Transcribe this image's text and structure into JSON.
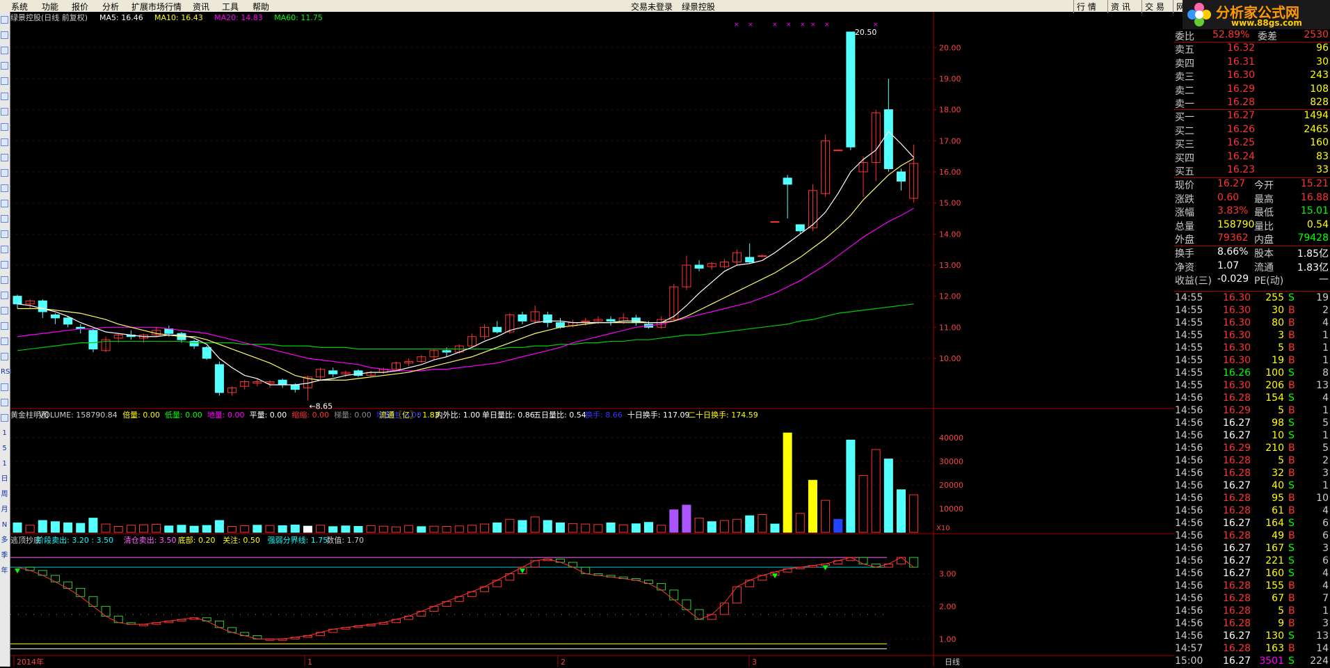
{
  "menu": [
    "系统",
    "功能",
    "报价",
    "分析",
    "扩展市场行情",
    "资讯",
    "工具",
    "帮助"
  ],
  "menu_center": [
    "交易未登录",
    "绿景控股"
  ],
  "right_tabs": [
    "行 情",
    "资 讯",
    "交 易",
    "网 上"
  ],
  "logo": {
    "text": "分析家公式网",
    "url": "www.88gs.com"
  },
  "left_tools": [
    "",
    "",
    "",
    "",
    "",
    "",
    "",
    "",
    "",
    "",
    "",
    "",
    "",
    "",
    "",
    "",
    "",
    "",
    "",
    "",
    "",
    "",
    "",
    "RSI",
    "",
    "",
    "",
    "1",
    "5",
    "1",
    "日",
    "周",
    "月",
    "N",
    "多",
    "季",
    "年"
  ],
  "price_header": {
    "name": "绿景控股(日线 前复权)",
    "ma5": "MA5: 16.46",
    "ma10": "MA10: 16.43",
    "ma20": "MA20: 14.83",
    "ma60": "MA60: 11.75"
  },
  "price_axis": [
    "20.00",
    "19.00",
    "18.00",
    "17.00",
    "16.00",
    "15.00",
    "14.00",
    "13.00",
    "12.00",
    "11.00",
    "10.00"
  ],
  "price_annotations": {
    "high": "20.50",
    "low": "8.65"
  },
  "vol_header": [
    {
      "t": "黄金柱明图",
      "c": "#cccccc"
    },
    {
      "t": "VOLUME: 158790.84",
      "c": "#cccccc"
    },
    {
      "t": "倍量: 0.00",
      "c": "#ffff00"
    },
    {
      "t": "低量: 0.00",
      "c": "#00ff00"
    },
    {
      "t": "地量: 0.00",
      "c": "#ff00ff"
    },
    {
      "t": "平量: 0.00",
      "c": "#ffffff"
    },
    {
      "t": "缩缩: 0.00",
      "c": "#ff3333"
    },
    {
      "t": "梯量: 0.00",
      "c": "#888888"
    },
    {
      "t": "增量柱: 0.00",
      "c": "#3333ff"
    },
    {
      "t": "流通〖亿〗: 1.83",
      "c": "#ffff00"
    },
    {
      "t": "内外比: 1.00",
      "c": "#ffffff"
    },
    {
      "t": "单日量比: 0.86",
      "c": "#ffffff"
    },
    {
      "t": "五日量比: 0.54",
      "c": "#ffffff"
    },
    {
      "t": "换手: 8.66",
      "c": "#3333ff"
    },
    {
      "t": "十日换手: 117.09",
      "c": "#ffffff"
    },
    {
      "t": "二十日换手: 174.59",
      "c": "#ffff00"
    }
  ],
  "vol_axis": [
    "40000",
    "30000",
    "20000",
    "10000"
  ],
  "vol_unit": "X10",
  "ind_header": [
    {
      "t": "逃顶抄底",
      "c": "#cccccc"
    },
    {
      "t": "阶段卖出: 3.20 : 3.50",
      "c": "#00ffff"
    },
    {
      "t": "清仓卖出: 3.50",
      "c": "#ff66ff"
    },
    {
      "t": "底部: 0.20",
      "c": "#ffff00"
    },
    {
      "t": "关注: 0.50",
      "c": "#ffff00"
    },
    {
      "t": "强弱分界线: 1.75",
      "c": "#00ffff"
    },
    {
      "t": "数值: 1.70",
      "c": "#cccccc"
    }
  ],
  "ind_axis": [
    "3.00",
    "2.00",
    "1.00"
  ],
  "time_axis": [
    {
      "t": "2014年",
      "x": 5
    },
    {
      "t": "1",
      "x": 423
    },
    {
      "t": "2",
      "x": 787
    },
    {
      "t": "3",
      "x": 1062
    }
  ],
  "period_label": "日线",
  "quote": {
    "weibi": {
      "label": "委比",
      "value": "52.89%",
      "label2": "委差",
      "value2": "2530"
    },
    "asks": [
      {
        "label": "卖五",
        "price": "16.32",
        "vol": "96"
      },
      {
        "label": "卖四",
        "price": "16.31",
        "vol": "30"
      },
      {
        "label": "卖三",
        "price": "16.30",
        "vol": "243"
      },
      {
        "label": "卖二",
        "price": "16.29",
        "vol": "108"
      },
      {
        "label": "卖一",
        "price": "16.28",
        "vol": "828"
      }
    ],
    "bids": [
      {
        "label": "买一",
        "price": "16.27",
        "vol": "1494"
      },
      {
        "label": "买二",
        "price": "16.26",
        "vol": "2465"
      },
      {
        "label": "买三",
        "price": "16.25",
        "vol": "160"
      },
      {
        "label": "买四",
        "price": "16.24",
        "vol": "83"
      },
      {
        "label": "买五",
        "price": "16.23",
        "vol": "33"
      }
    ],
    "stats": [
      {
        "l1": "现价",
        "v1": "16.27",
        "l2": "今开",
        "v2": "15.21"
      },
      {
        "l1": "涨跌",
        "v1": "0.60",
        "l2": "最高",
        "v2": "16.88"
      },
      {
        "l1": "涨幅",
        "v1": "3.83%",
        "l2": "最低",
        "v2": "15.01"
      },
      {
        "l1": "总量",
        "v1": "158790",
        "l2": "量比",
        "v2": "0.54"
      },
      {
        "l1": "外盘",
        "v1": "79362",
        "l2": "内盘",
        "v2": "79428"
      }
    ],
    "stats2": [
      {
        "l1": "换手",
        "v1": "8.66%",
        "l2": "股本",
        "v2": "1.85亿"
      },
      {
        "l1": "净资",
        "v1": "1.07",
        "l2": "流通",
        "v2": "1.83亿"
      },
      {
        "l1": "收益(三)",
        "v1": "-0.029",
        "l2": "PE(动)",
        "v2": "—"
      }
    ]
  },
  "ticks": [
    {
      "t": "14:55",
      "p": "16.30",
      "v": "255",
      "s": "S",
      "n": "19"
    },
    {
      "t": "14:55",
      "p": "16.30",
      "v": "30",
      "s": "B",
      "n": "2"
    },
    {
      "t": "14:55",
      "p": "16.30",
      "v": "80",
      "s": "B",
      "n": "4"
    },
    {
      "t": "14:55",
      "p": "16.30",
      "v": "3",
      "s": "B",
      "n": "1"
    },
    {
      "t": "14:55",
      "p": "16.30",
      "v": "5",
      "s": "B",
      "n": "1"
    },
    {
      "t": "14:55",
      "p": "16.30",
      "v": "19",
      "s": "B",
      "n": "1"
    },
    {
      "t": "14:55",
      "p": "16.26",
      "v": "100",
      "s": "S",
      "n": "8"
    },
    {
      "t": "14:55",
      "p": "16.30",
      "v": "206",
      "s": "B",
      "n": "13"
    },
    {
      "t": "14:56",
      "p": "16.28",
      "v": "154",
      "s": "S",
      "n": "4"
    },
    {
      "t": "14:56",
      "p": "16.29",
      "v": "5",
      "s": "B",
      "n": "1"
    },
    {
      "t": "14:56",
      "p": "16.27",
      "v": "98",
      "s": "S",
      "n": "5"
    },
    {
      "t": "14:56",
      "p": "16.27",
      "v": "10",
      "s": "S",
      "n": "1"
    },
    {
      "t": "14:56",
      "p": "16.29",
      "v": "210",
      "s": "B",
      "n": "5"
    },
    {
      "t": "14:56",
      "p": "16.28",
      "v": "5",
      "s": "B",
      "n": "2"
    },
    {
      "t": "14:56",
      "p": "16.28",
      "v": "32",
      "s": "B",
      "n": "3"
    },
    {
      "t": "14:56",
      "p": "16.27",
      "v": "40",
      "s": "S",
      "n": "1"
    },
    {
      "t": "14:56",
      "p": "16.28",
      "v": "95",
      "s": "B",
      "n": "10"
    },
    {
      "t": "14:56",
      "p": "16.28",
      "v": "61",
      "s": "B",
      "n": "4"
    },
    {
      "t": "14:56",
      "p": "16.27",
      "v": "164",
      "s": "S",
      "n": "6"
    },
    {
      "t": "14:56",
      "p": "16.28",
      "v": "49",
      "s": "B",
      "n": "6"
    },
    {
      "t": "14:56",
      "p": "16.27",
      "v": "167",
      "s": "S",
      "n": "3"
    },
    {
      "t": "14:56",
      "p": "16.27",
      "v": "221",
      "s": "S",
      "n": "6"
    },
    {
      "t": "14:56",
      "p": "16.27",
      "v": "160",
      "s": "S",
      "n": "4"
    },
    {
      "t": "14:56",
      "p": "16.28",
      "v": "155",
      "s": "B",
      "n": "4"
    },
    {
      "t": "14:56",
      "p": "16.28",
      "v": "67",
      "s": "B",
      "n": "7"
    },
    {
      "t": "14:56",
      "p": "16.28",
      "v": "5",
      "s": "B",
      "n": "1"
    },
    {
      "t": "14:56",
      "p": "16.28",
      "v": "9",
      "s": "B",
      "n": "3"
    },
    {
      "t": "14:56",
      "p": "16.27",
      "v": "130",
      "s": "S",
      "n": "13"
    },
    {
      "t": "14:57",
      "p": "16.28",
      "v": "163",
      "s": "B",
      "n": "14"
    },
    {
      "t": "15:00",
      "p": "16.27",
      "v": "3501",
      "s": "S",
      "n": "224"
    }
  ],
  "colors": {
    "up": "#ff3333",
    "down": "#54ffff",
    "white": "#ffffff",
    "yellow": "#ffff00",
    "green": "#00ff00",
    "magenta": "#ff00ff"
  },
  "chart_data": {
    "type": "candlestick",
    "ylim": [
      8.5,
      20.7
    ],
    "candles": [
      [
        12.0,
        11.75,
        12.05,
        11.6
      ],
      [
        11.75,
        11.85,
        11.9,
        11.6
      ],
      [
        11.85,
        11.5,
        11.9,
        11.3
      ],
      [
        11.4,
        11.3,
        11.45,
        11.1
      ],
      [
        11.3,
        11.1,
        11.35,
        11.0
      ],
      [
        11.0,
        10.95,
        11.1,
        10.8
      ],
      [
        10.9,
        10.3,
        10.95,
        10.2
      ],
      [
        10.25,
        10.6,
        10.7,
        10.2
      ],
      [
        10.65,
        10.75,
        10.8,
        10.5
      ],
      [
        10.75,
        10.7,
        10.9,
        10.6
      ],
      [
        10.65,
        10.75,
        10.8,
        10.5
      ],
      [
        10.75,
        10.9,
        11.0,
        10.7
      ],
      [
        10.95,
        10.8,
        11.05,
        10.7
      ],
      [
        10.8,
        10.6,
        10.85,
        10.5
      ],
      [
        10.55,
        10.4,
        10.6,
        10.3
      ],
      [
        10.35,
        10.0,
        10.4,
        9.95
      ],
      [
        9.8,
        8.9,
        9.9,
        8.8
      ],
      [
        8.9,
        9.05,
        9.1,
        8.8
      ],
      [
        9.1,
        9.25,
        9.3,
        9.0
      ],
      [
        9.2,
        9.25,
        9.35,
        9.1
      ],
      [
        9.2,
        9.25,
        9.3,
        9.05
      ],
      [
        9.3,
        9.15,
        9.35,
        9.05
      ],
      [
        9.15,
        9.0,
        9.2,
        8.9
      ],
      [
        9.05,
        9.4,
        9.45,
        8.65
      ],
      [
        9.4,
        9.65,
        9.7,
        9.3
      ],
      [
        9.6,
        9.5,
        9.7,
        9.4
      ],
      [
        9.5,
        9.55,
        9.6,
        9.4
      ],
      [
        9.6,
        9.45,
        9.65,
        9.4
      ],
      [
        9.45,
        9.55,
        9.6,
        9.4
      ],
      [
        9.55,
        9.65,
        9.7,
        9.5
      ],
      [
        9.65,
        9.85,
        9.9,
        9.6
      ],
      [
        9.85,
        9.9,
        10.0,
        9.75
      ],
      [
        9.9,
        10.05,
        10.1,
        9.85
      ],
      [
        10.05,
        10.25,
        10.3,
        9.95
      ],
      [
        10.25,
        10.2,
        10.35,
        10.05
      ],
      [
        10.2,
        10.4,
        10.45,
        10.15
      ],
      [
        10.4,
        10.7,
        10.8,
        10.35
      ],
      [
        10.7,
        11.0,
        11.1,
        10.6
      ],
      [
        11.0,
        10.85,
        11.2,
        10.8
      ],
      [
        10.85,
        11.4,
        11.45,
        10.8
      ],
      [
        11.4,
        11.2,
        11.5,
        11.1
      ],
      [
        11.2,
        11.5,
        11.7,
        11.1
      ],
      [
        11.4,
        11.15,
        11.5,
        11.0
      ],
      [
        11.15,
        11.0,
        11.3,
        10.95
      ],
      [
        11.05,
        11.15,
        11.25,
        11.0
      ],
      [
        11.2,
        11.2,
        11.3,
        11.05
      ],
      [
        11.2,
        11.25,
        11.35,
        11.1
      ],
      [
        11.25,
        11.2,
        11.35,
        11.05
      ],
      [
        11.2,
        11.3,
        11.45,
        11.1
      ],
      [
        11.3,
        11.15,
        11.4,
        11.05
      ],
      [
        11.1,
        11.0,
        11.2,
        10.95
      ],
      [
        11.0,
        11.25,
        11.35,
        10.95
      ],
      [
        11.25,
        12.3,
        12.4,
        11.2
      ],
      [
        12.3,
        13.0,
        13.3,
        12.2
      ],
      [
        13.0,
        12.9,
        13.15,
        12.8
      ],
      [
        12.95,
        13.05,
        13.1,
        12.85
      ],
      [
        12.95,
        13.1,
        13.2,
        12.9
      ],
      [
        13.1,
        13.4,
        13.5,
        13.0
      ],
      [
        13.25,
        13.1,
        13.7,
        13.05
      ],
      [
        13.3,
        13.3,
        13.35,
        13.25
      ],
      [
        14.4,
        14.4,
        14.4,
        14.4
      ],
      [
        15.8,
        15.6,
        15.9,
        14.5
      ],
      [
        14.3,
        14.1,
        14.3,
        14.0
      ],
      [
        14.2,
        15.4,
        15.6,
        14.1
      ],
      [
        15.3,
        17.0,
        17.2,
        15.2
      ],
      [
        16.7,
        16.7,
        16.7,
        16.7
      ],
      [
        20.5,
        16.8,
        20.5,
        16.7
      ],
      [
        16.0,
        16.3,
        16.5,
        15.2
      ],
      [
        16.3,
        17.9,
        18.0,
        15.7
      ],
      [
        18.0,
        16.1,
        19.0,
        16.0
      ],
      [
        16.0,
        15.7,
        16.1,
        15.4
      ],
      [
        15.15,
        16.27,
        16.88,
        15.01
      ]
    ],
    "ma5": [
      11.75,
      11.7,
      11.6,
      11.5,
      11.35,
      11.15,
      11.0,
      10.85,
      10.8,
      10.75,
      10.7,
      10.7,
      10.75,
      10.75,
      10.65,
      10.45,
      10.0,
      9.7,
      9.45,
      9.35,
      9.15,
      9.15,
      9.15,
      9.2,
      9.3,
      9.35,
      9.45,
      9.5,
      9.55,
      9.55,
      9.6,
      9.7,
      9.8,
      9.95,
      10.05,
      10.2,
      10.35,
      10.55,
      10.7,
      10.9,
      11.0,
      11.15,
      11.2,
      11.2,
      11.15,
      11.15,
      11.15,
      11.15,
      11.2,
      11.2,
      11.15,
      11.15,
      11.35,
      11.7,
      12.1,
      12.45,
      12.8,
      13.0,
      13.05,
      13.15,
      13.4,
      13.7,
      14.0,
      14.3,
      14.7,
      15.3,
      16.0,
      16.4,
      16.7,
      17.3,
      16.9,
      16.46
    ],
    "ma10": [
      11.6,
      11.6,
      11.6,
      11.55,
      11.5,
      11.45,
      11.35,
      11.25,
      11.1,
      11.0,
      10.9,
      10.8,
      10.75,
      10.7,
      10.7,
      10.6,
      10.45,
      10.3,
      10.15,
      10.0,
      9.85,
      9.65,
      9.45,
      9.35,
      9.3,
      9.3,
      9.3,
      9.35,
      9.4,
      9.45,
      9.5,
      9.55,
      9.65,
      9.75,
      9.85,
      9.95,
      10.05,
      10.2,
      10.35,
      10.5,
      10.65,
      10.8,
      10.9,
      11.0,
      11.05,
      11.1,
      11.15,
      11.15,
      11.15,
      11.15,
      11.15,
      11.15,
      11.2,
      11.35,
      11.55,
      11.75,
      11.95,
      12.15,
      12.35,
      12.55,
      12.75,
      13.0,
      13.25,
      13.55,
      13.85,
      14.2,
      14.6,
      15.1,
      15.5,
      15.9,
      16.2,
      16.43
    ],
    "ma20": [
      10.7,
      10.75,
      10.8,
      10.85,
      10.9,
      10.95,
      10.95,
      11.0,
      11.0,
      11.0,
      11.0,
      11.0,
      10.95,
      10.9,
      10.85,
      10.8,
      10.7,
      10.6,
      10.5,
      10.4,
      10.3,
      10.2,
      10.1,
      10.0,
      9.95,
      9.9,
      9.85,
      9.8,
      9.7,
      9.65,
      9.6,
      9.6,
      9.6,
      9.65,
      9.65,
      9.7,
      9.75,
      9.8,
      9.85,
      9.95,
      10.05,
      10.15,
      10.25,
      10.35,
      10.5,
      10.6,
      10.7,
      10.8,
      10.9,
      11.0,
      11.05,
      11.1,
      11.2,
      11.3,
      11.4,
      11.5,
      11.6,
      11.7,
      11.8,
      11.95,
      12.1,
      12.3,
      12.5,
      12.75,
      13.0,
      13.3,
      13.6,
      13.9,
      14.15,
      14.4,
      14.6,
      14.83
    ],
    "ma60": [
      10.25,
      10.3,
      10.35,
      10.4,
      10.45,
      10.5,
      10.5,
      10.55,
      10.55,
      10.55,
      10.55,
      10.55,
      10.55,
      10.55,
      10.5,
      10.5,
      10.5,
      10.5,
      10.45,
      10.45,
      10.45,
      10.4,
      10.4,
      10.4,
      10.35,
      10.35,
      10.35,
      10.3,
      10.3,
      10.3,
      10.3,
      10.3,
      10.3,
      10.3,
      10.3,
      10.3,
      10.3,
      10.3,
      10.3,
      10.35,
      10.35,
      10.4,
      10.4,
      10.45,
      10.45,
      10.5,
      10.5,
      10.55,
      10.55,
      10.6,
      10.6,
      10.65,
      10.7,
      10.75,
      10.75,
      10.8,
      10.85,
      10.9,
      10.95,
      11.0,
      11.05,
      11.1,
      11.2,
      11.25,
      11.35,
      11.45,
      11.5,
      11.55,
      11.6,
      11.65,
      11.7,
      11.75
    ],
    "volume": [
      4000,
      3000,
      5000,
      4500,
      4000,
      3800,
      6000,
      3500,
      2500,
      3000,
      3200,
      3400,
      2700,
      3000,
      2600,
      2900,
      5000,
      2500,
      2800,
      3000,
      2900,
      2800,
      3100,
      2600,
      3000,
      2400,
      2700,
      2500,
      2800,
      2600,
      2300,
      2900,
      2400,
      2600,
      2500,
      2700,
      3000,
      3500,
      4000,
      5500,
      5000,
      6500,
      5000,
      4000,
      3700,
      3500,
      3300,
      4000,
      3200,
      3600,
      4200,
      3000,
      9500,
      11500,
      6000,
      4500,
      5000,
      5500,
      7000,
      7500,
      3500,
      42000,
      8000,
      22000,
      13500,
      5500,
      39000,
      24000,
      35000,
      31000,
      18000,
      15879
    ],
    "vol_colors": [
      "down",
      "up",
      "down",
      "down",
      "down",
      "down",
      "down",
      "up",
      "up",
      "up",
      "up",
      "up",
      "down",
      "down",
      "down",
      "down",
      "down",
      "up",
      "up",
      "down",
      "up",
      "down",
      "down",
      "white",
      "up",
      "down",
      "down",
      "down",
      "up",
      "up",
      "up",
      "up",
      "down",
      "up",
      "up",
      "up",
      "up",
      "up",
      "down",
      "up",
      "down",
      "up",
      "down",
      "down",
      "up",
      "up",
      "up",
      "down",
      "up",
      "down",
      "down",
      "up",
      "magenta",
      "magenta",
      "up",
      "down",
      "up",
      "up",
      "down",
      "up",
      "down",
      "yellow",
      "up",
      "yellow",
      "up",
      "blue",
      "down",
      "up",
      "up",
      "down",
      "down",
      "up"
    ],
    "indicator": [
      3.2,
      3.1,
      2.95,
      2.75,
      2.55,
      2.3,
      2.0,
      1.7,
      1.5,
      1.45,
      1.45,
      1.5,
      1.55,
      1.6,
      1.65,
      1.55,
      1.35,
      1.2,
      1.1,
      1.0,
      1.0,
      1.0,
      1.05,
      1.1,
      1.2,
      1.3,
      1.35,
      1.4,
      1.45,
      1.5,
      1.6,
      1.7,
      1.85,
      2.0,
      2.15,
      2.3,
      2.45,
      2.6,
      2.8,
      3.0,
      3.2,
      3.4,
      3.45,
      3.35,
      3.2,
      3.0,
      2.95,
      2.9,
      2.85,
      2.8,
      2.7,
      2.5,
      2.2,
      1.9,
      1.6,
      1.75,
      2.1,
      2.6,
      2.8,
      2.95,
      3.05,
      3.15,
      3.2,
      3.25,
      3.3,
      3.4,
      3.5,
      3.3,
      3.2,
      3.3,
      3.5,
      3.2,
      2.8,
      2.6,
      2.4,
      2.2,
      2.0,
      1.75,
      1.7
    ]
  }
}
